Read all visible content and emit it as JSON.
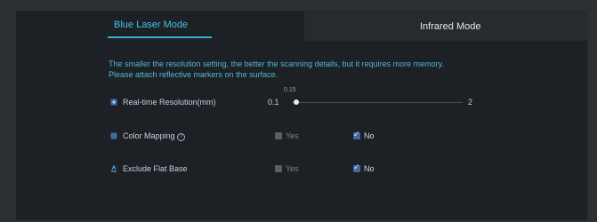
{
  "tabs": [
    {
      "label": "Blue Laser Mode",
      "active": true
    },
    {
      "label": "Infrared Mode",
      "active": false
    }
  ],
  "description": {
    "line1": "The smaller the resolution setting, the better the scanning details, but it requires more memory.",
    "line2": "Please attach reflective markers on the surface."
  },
  "resolution": {
    "label": "Real-time Resolution(mm)",
    "min": "0.1",
    "max": "2",
    "current": "0.15",
    "value": 0.15
  },
  "color_mapping": {
    "label": "Color Mapping",
    "help_icon": "question-circle-icon",
    "yes_label": "Yes",
    "no_label": "No",
    "yes_checked": false,
    "no_checked": true
  },
  "exclude_flat_base": {
    "label": "Exclude Flat Base",
    "yes_label": "Yes",
    "no_label": "No",
    "yes_checked": false,
    "no_checked": true
  },
  "colors": {
    "accent": "#40c4e8",
    "description_text": "#4fb7d6",
    "checkbox_checked": "#3f6b9e"
  },
  "icons": {
    "resolution": "resolution-icon",
    "color_mapping": "color-palette-icon",
    "exclude_flat_base": "flat-base-icon"
  }
}
